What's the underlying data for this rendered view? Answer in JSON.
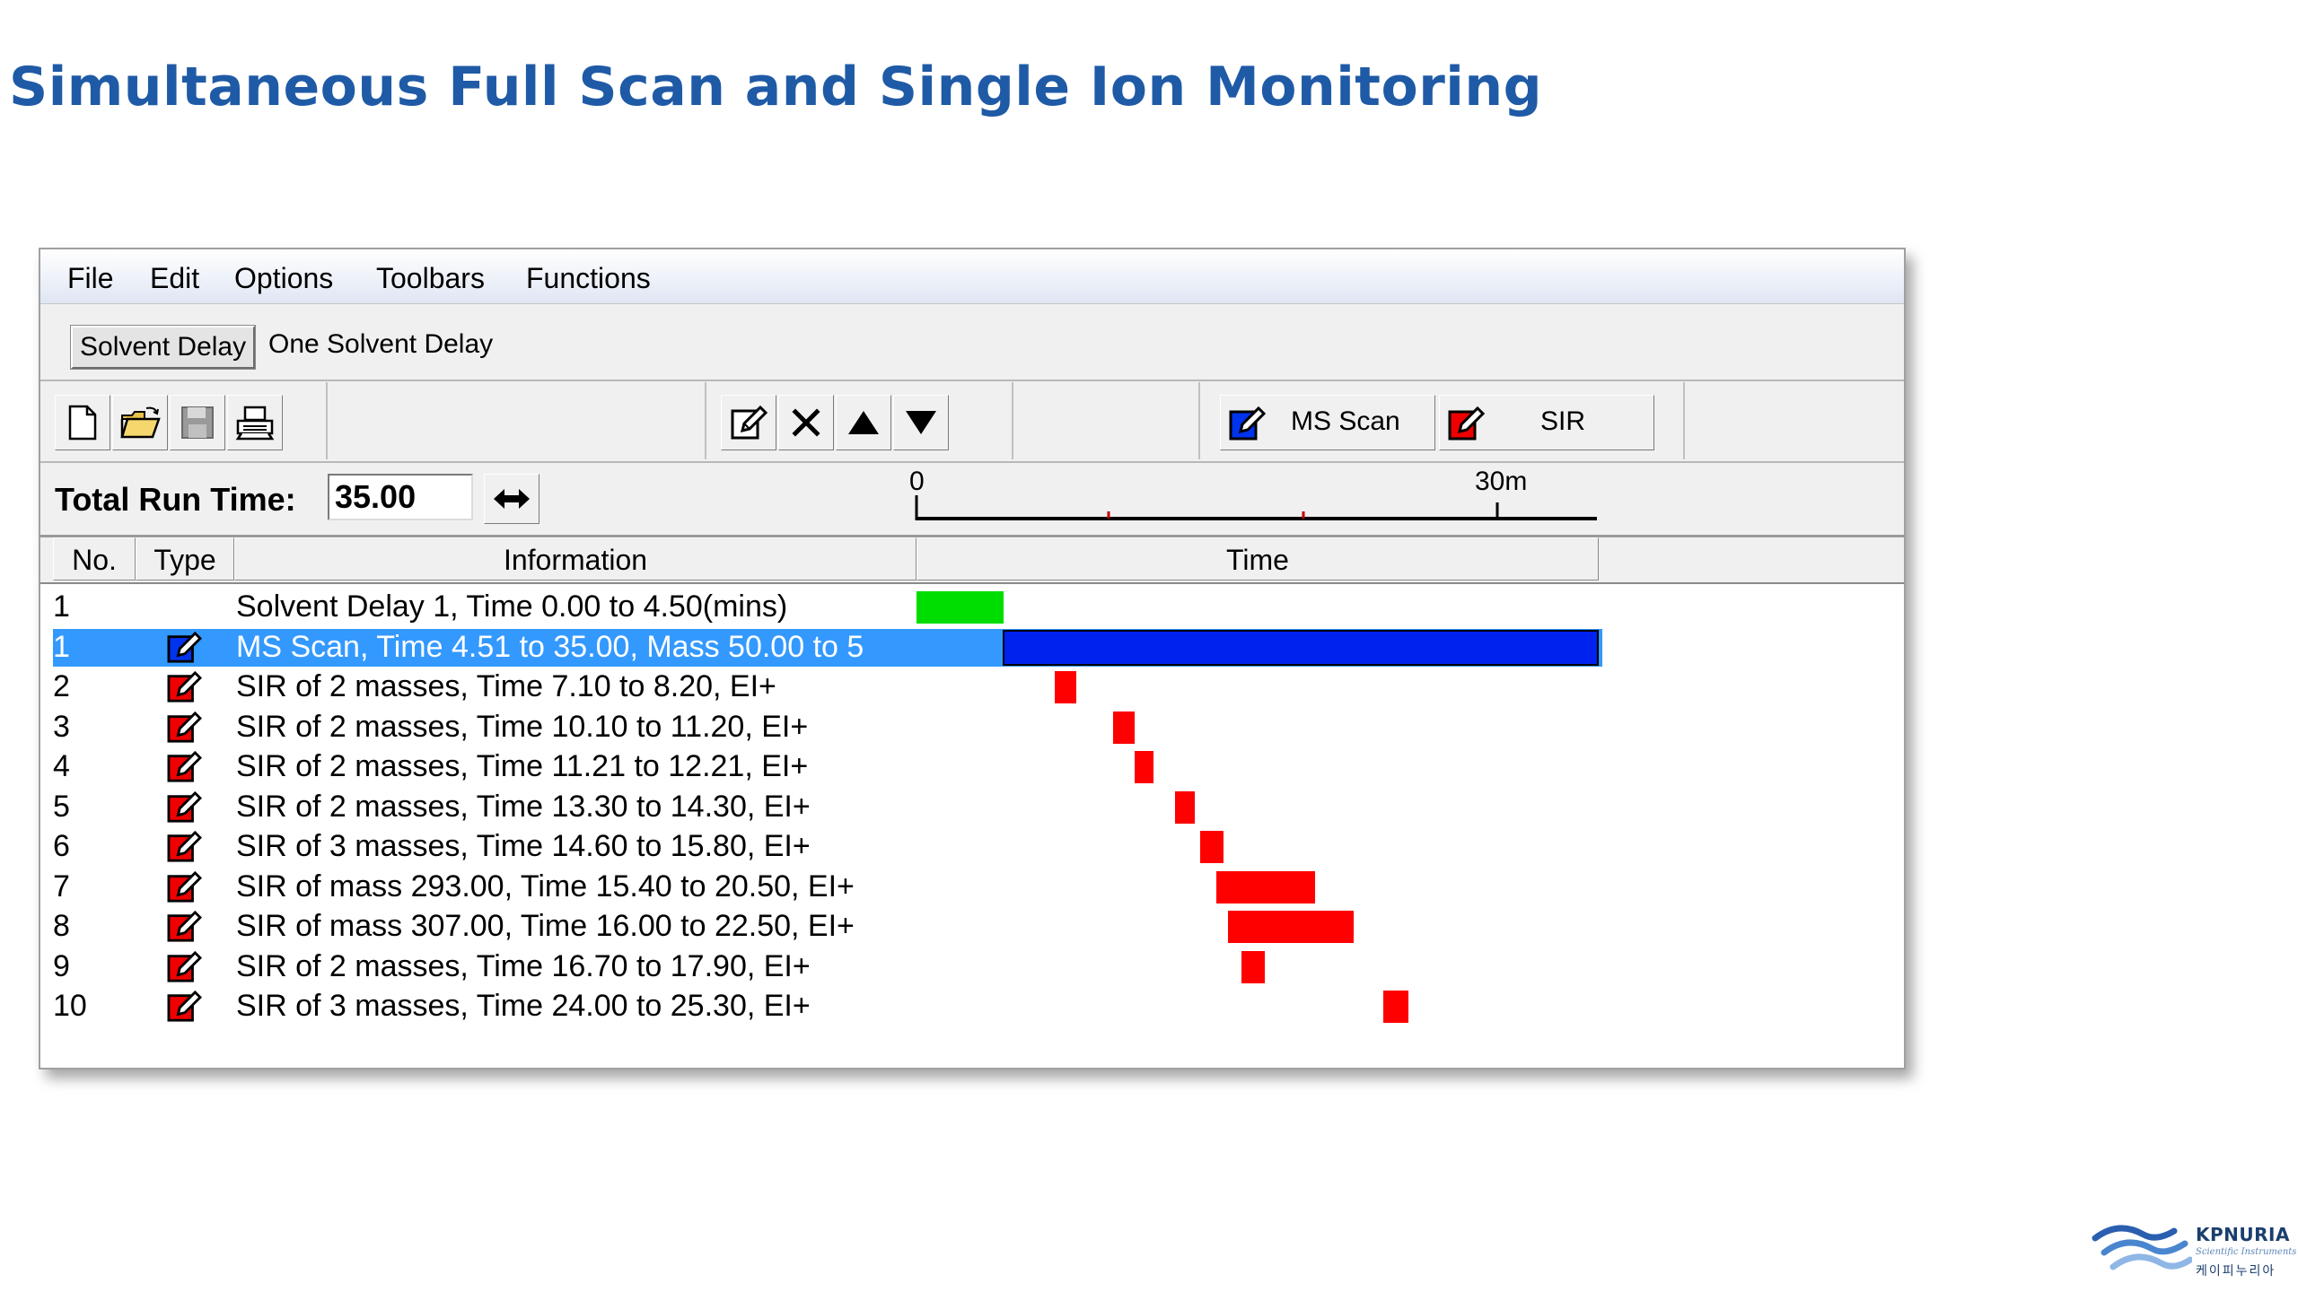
{
  "slide": {
    "title": "Simultaneous Full Scan and Single Ion Monitoring"
  },
  "menu": [
    "File",
    "Edit",
    "Options",
    "Toolbars",
    "Functions"
  ],
  "function_bar": {
    "button_label": "Solvent Delay",
    "description": "One Solvent Delay"
  },
  "toolbar": {
    "ms_scan_label": "MS Scan",
    "sir_label": "SIR"
  },
  "run": {
    "label": "Total Run Time:",
    "value": "35.00",
    "ruler_start": "0",
    "ruler_mark": "30m"
  },
  "table": {
    "headers": {
      "no": "No.",
      "type": "Type",
      "information": "Information",
      "time": "Time"
    },
    "time_axis_max_min": 35,
    "rows": [
      {
        "no": "1",
        "type": "none",
        "info": "Solvent Delay 1, Time 0.00 to 4.50(mins)",
        "start": 0.0,
        "end": 4.5,
        "color": "#00dd00"
      },
      {
        "no": "1",
        "type": "ms-scan",
        "info": "MS Scan, Time 4.51 to 35.00, Mass 50.00 to 5",
        "start": 4.51,
        "end": 35.0,
        "color": "#0022ee",
        "selected": true
      },
      {
        "no": "2",
        "type": "sir",
        "info": "SIR of 2 masses, Time 7.10 to 8.20, EI+",
        "start": 7.1,
        "end": 8.2,
        "color": "#ff0000"
      },
      {
        "no": "3",
        "type": "sir",
        "info": "SIR of 2 masses, Time 10.10 to 11.20, EI+",
        "start": 10.1,
        "end": 11.2,
        "color": "#ff0000"
      },
      {
        "no": "4",
        "type": "sir",
        "info": "SIR of 2 masses, Time 11.21 to 12.21, EI+",
        "start": 11.21,
        "end": 12.21,
        "color": "#ff0000"
      },
      {
        "no": "5",
        "type": "sir",
        "info": "SIR of 2 masses, Time 13.30 to 14.30, EI+",
        "start": 13.3,
        "end": 14.3,
        "color": "#ff0000"
      },
      {
        "no": "6",
        "type": "sir",
        "info": "SIR of 3 masses, Time 14.60 to 15.80, EI+",
        "start": 14.6,
        "end": 15.8,
        "color": "#ff0000"
      },
      {
        "no": "7",
        "type": "sir",
        "info": "SIR of mass 293.00, Time 15.40 to 20.50, EI+",
        "start": 15.4,
        "end": 20.5,
        "color": "#ff0000"
      },
      {
        "no": "8",
        "type": "sir",
        "info": "SIR of mass 307.00, Time 16.00 to 22.50, EI+",
        "start": 16.0,
        "end": 22.5,
        "color": "#ff0000"
      },
      {
        "no": "9",
        "type": "sir",
        "info": "SIR of 2 masses, Time 16.70 to 17.90, EI+",
        "start": 16.7,
        "end": 17.9,
        "color": "#ff0000"
      },
      {
        "no": "10",
        "type": "sir",
        "info": "SIR of 3 masses, Time 24.00 to 25.30, EI+",
        "start": 24.0,
        "end": 25.3,
        "color": "#ff0000"
      }
    ]
  },
  "colors": {
    "title": "#1f5aa6",
    "selection": "#3399ff",
    "ms_scan_bar": "#0022ee",
    "sir_bar": "#ff0000",
    "solvent_bar": "#00dd00"
  },
  "logo": {
    "name": "KPNURIA",
    "subtitle": "Scientific Instruments",
    "korean": "케이피누리아"
  }
}
